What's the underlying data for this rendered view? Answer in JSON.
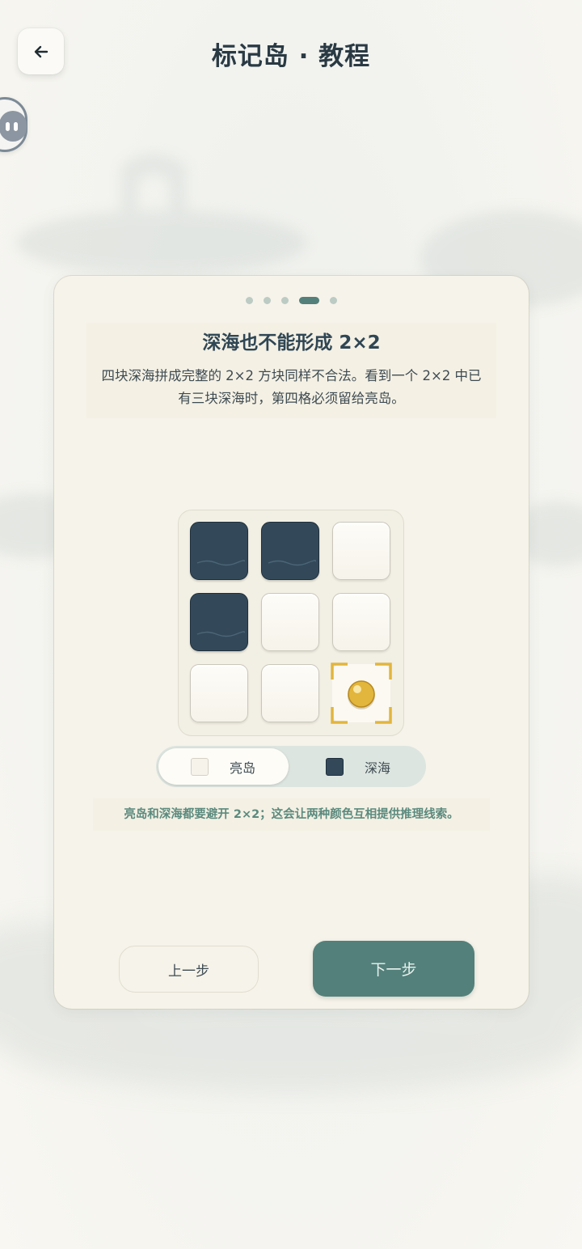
{
  "header": {
    "title": "标记岛 · 教程"
  },
  "tutorial": {
    "page_index": 4,
    "page_count": 5,
    "title": "深海也不能形成 2×2",
    "description_line1": "四块深海拼成完整的 2×2 方块同样不合法。看到一个 2×2 中已",
    "description_line2": "有三块深海时，第四格必须留给亮岛。",
    "board": [
      [
        "deep",
        "deep",
        "light"
      ],
      [
        "deep",
        "light",
        "light"
      ],
      [
        "light",
        "light",
        "target"
      ]
    ],
    "legend": {
      "light_label": "亮岛",
      "dark_label": "深海",
      "selected": "亮岛"
    },
    "hint": "亮岛和深海都要避开 2×2；这会让两种颜色互相提供推理线索。"
  },
  "nav": {
    "prev_label": "上一步",
    "next_label": "下一步"
  },
  "colors": {
    "accent": "#53807a",
    "deep_sea": "#33495a",
    "light_island": "#f6f3ea",
    "marker": "#e2b53c"
  }
}
